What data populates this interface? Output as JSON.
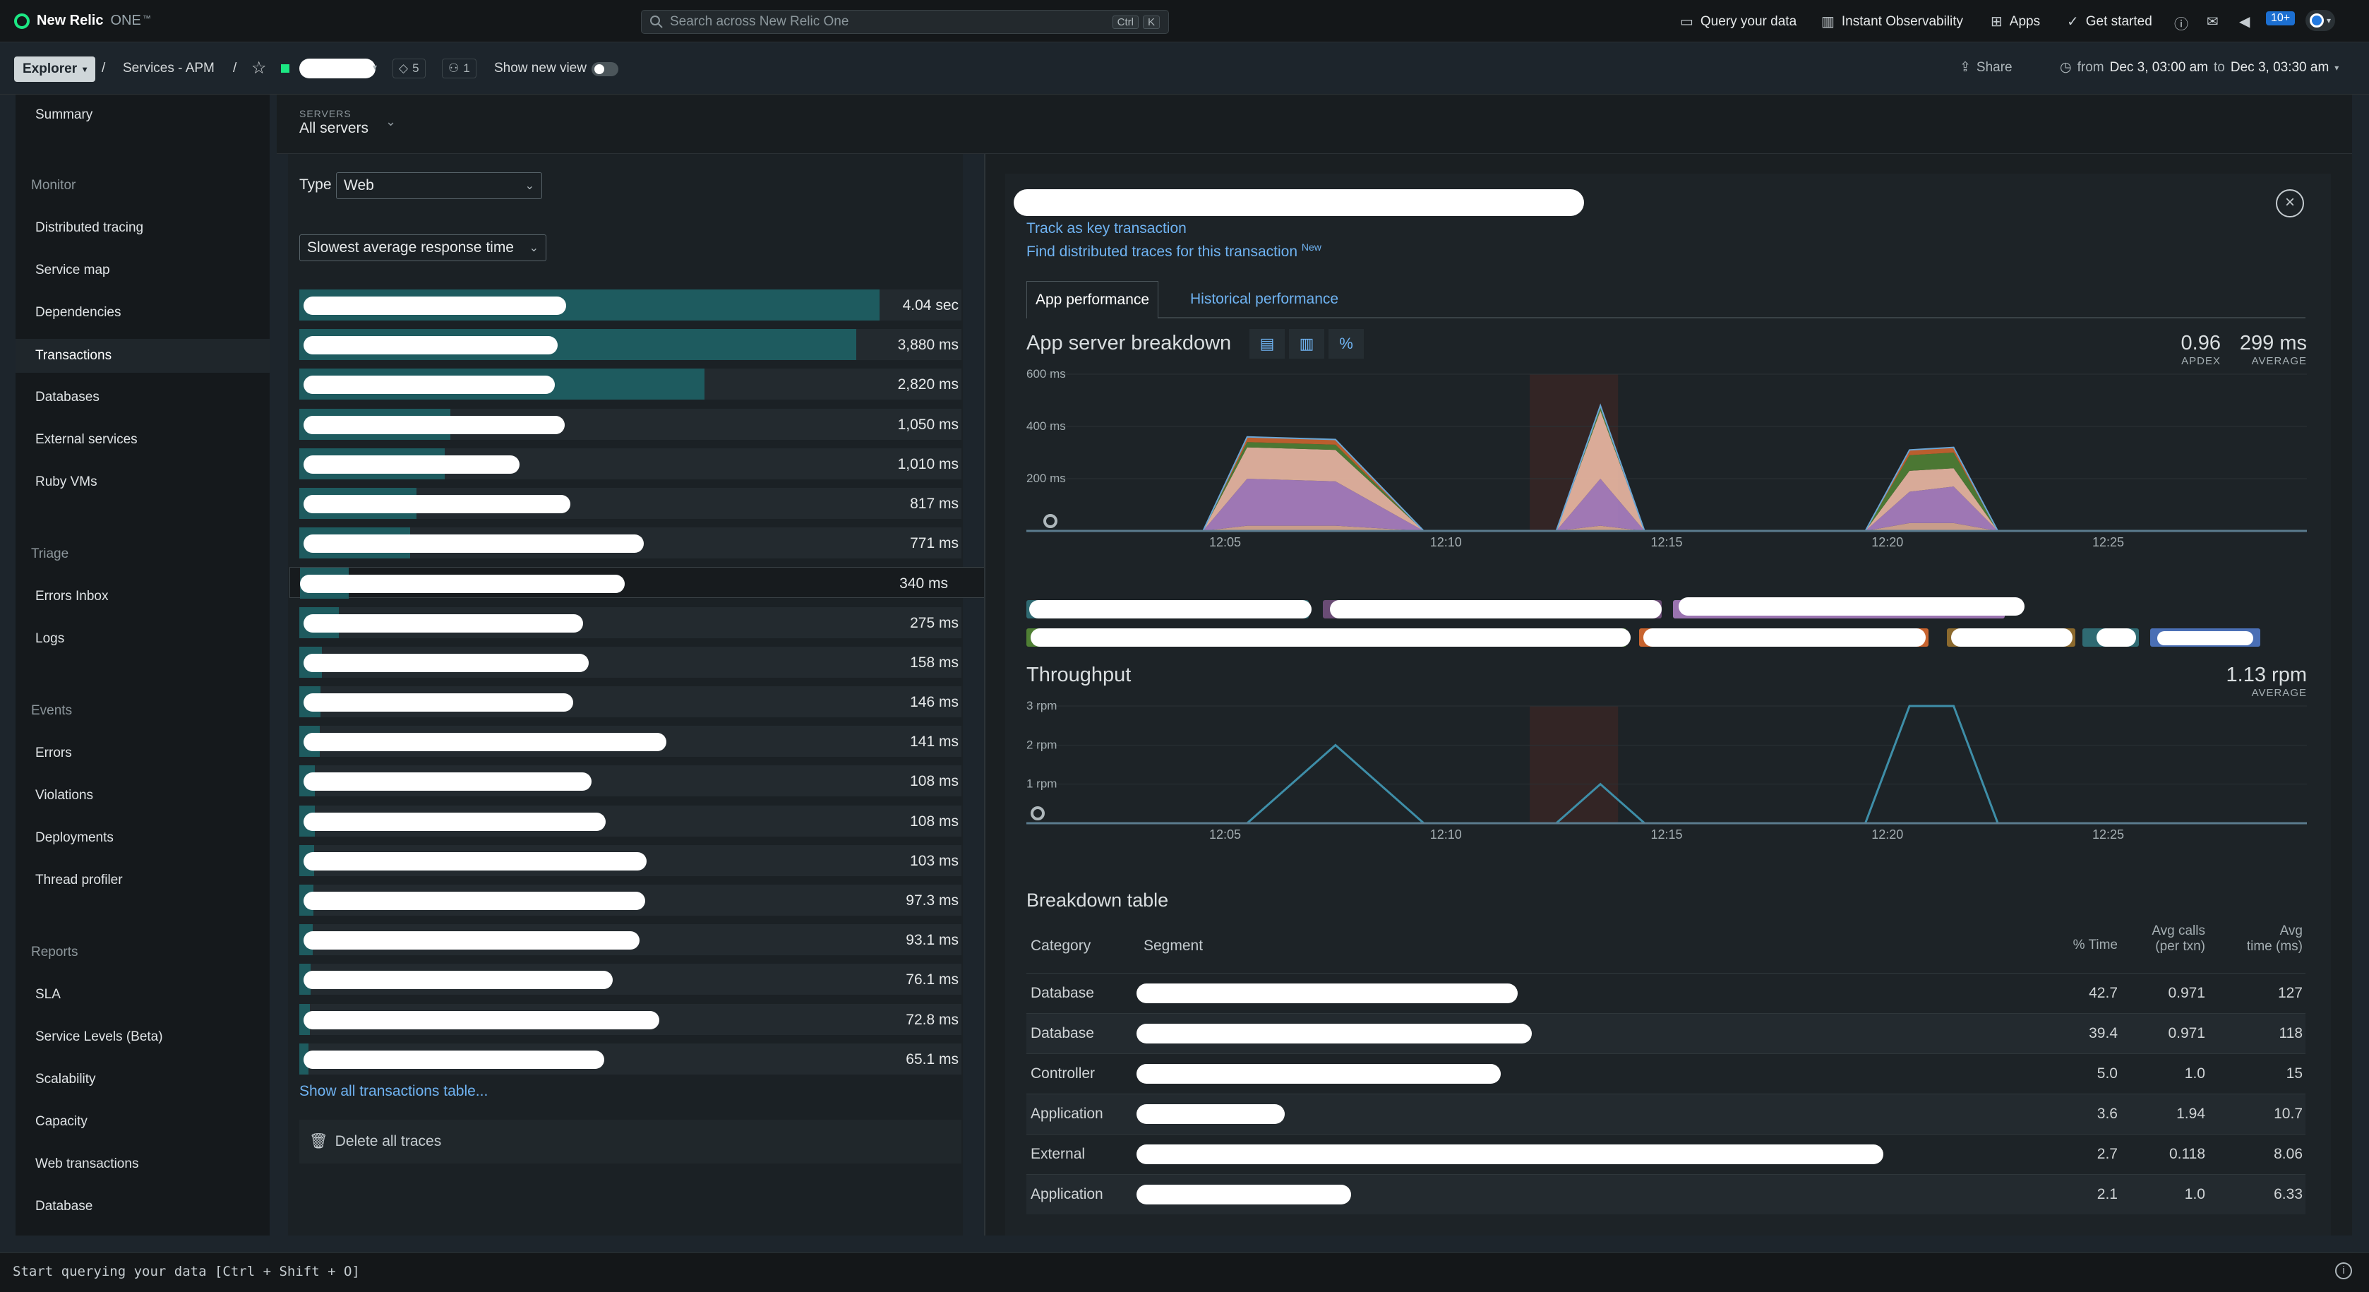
{
  "app": {
    "brand": "New Relic",
    "brand_suffix": "ONE",
    "tm": "™"
  },
  "search": {
    "placeholder": "Search across New Relic One",
    "shortcut": [
      "Ctrl",
      "K"
    ]
  },
  "top_actions": {
    "query": "Query your data",
    "observability": "Instant Observability",
    "apps": "Apps",
    "get_started": "Get started",
    "notifications_badge": "10+"
  },
  "subheader": {
    "explorer": "Explorer",
    "sep1": "/",
    "crumb": "Services - APM",
    "sep2": "/",
    "tags_count": "5",
    "workloads_count": "1",
    "show_new_view": "Show new view",
    "share": "Share",
    "time_from_label": "from",
    "time_from": "Dec 3, 03:00 am",
    "time_to_label": "to",
    "time_to": "Dec 3, 03:30 am"
  },
  "nav": {
    "summary": "Summary",
    "monitor_section": "Monitor",
    "monitor": [
      "Distributed tracing",
      "Service map",
      "Dependencies",
      "Transactions",
      "Databases",
      "External services",
      "Ruby VMs"
    ],
    "triage_section": "Triage",
    "triage": [
      "Errors Inbox",
      "Logs"
    ],
    "events_section": "Events",
    "events": [
      "Errors",
      "Violations",
      "Deployments",
      "Thread profiler"
    ],
    "reports_section": "Reports",
    "reports": [
      "SLA",
      "Service Levels (Beta)",
      "Scalability",
      "Capacity",
      "Web transactions",
      "Database"
    ]
  },
  "servers": {
    "label": "SERVERS",
    "value": "All servers"
  },
  "filters": {
    "type_label": "Type",
    "type_value": "Web",
    "sort_value": "Slowest average response time"
  },
  "transactions": [
    {
      "value": "4.04 sec",
      "fraction": 1.0
    },
    {
      "value": "3,880 ms",
      "fraction": 0.96
    },
    {
      "value": "2,820 ms",
      "fraction": 0.698
    },
    {
      "value": "1,050 ms",
      "fraction": 0.26
    },
    {
      "value": "1,010 ms",
      "fraction": 0.25
    },
    {
      "value": "817 ms",
      "fraction": 0.202
    },
    {
      "value": "771 ms",
      "fraction": 0.191
    },
    {
      "value": "340 ms",
      "fraction": 0.084
    },
    {
      "value": "275 ms",
      "fraction": 0.068
    },
    {
      "value": "158 ms",
      "fraction": 0.039
    },
    {
      "value": "146 ms",
      "fraction": 0.036
    },
    {
      "value": "141 ms",
      "fraction": 0.035
    },
    {
      "value": "108 ms",
      "fraction": 0.027
    },
    {
      "value": "108 ms",
      "fraction": 0.027
    },
    {
      "value": "103 ms",
      "fraction": 0.025
    },
    {
      "value": "97.3 ms",
      "fraction": 0.024
    },
    {
      "value": "93.1 ms",
      "fraction": 0.023
    },
    {
      "value": "76.1 ms",
      "fraction": 0.019
    },
    {
      "value": "72.8 ms",
      "fraction": 0.018
    },
    {
      "value": "65.1 ms",
      "fraction": 0.016
    }
  ],
  "list_footer": {
    "show_all": "Show all transactions table...",
    "delete_traces": "Delete all traces"
  },
  "detail": {
    "track_key": "Track as key transaction",
    "find_traces": "Find distributed traces for this transaction",
    "find_traces_badge": "New",
    "tab_app": "App performance",
    "tab_hist": "Historical performance",
    "breakdown_title": "App server breakdown",
    "apdex_value": "0.96",
    "apdex_label": "APDEX",
    "avg_value": "299 ms",
    "avg_label": "AVERAGE",
    "throughput_title": "Throughput",
    "throughput_value": "1.13 rpm",
    "throughput_label": "AVERAGE",
    "chart_btn_pct": "%"
  },
  "colors": {
    "teal_bar": "#1e5b5f",
    "link": "#6fb3f2",
    "accent_green": "#1ce783",
    "series_line": "#3e8ea8"
  },
  "chart_data": [
    {
      "type": "area",
      "ylim": [
        0,
        600
      ],
      "yticks": [
        "600 ms",
        "400 ms",
        "200 ms"
      ],
      "xticks": [
        "12:05",
        "12:10",
        "12:15",
        "12:20",
        "12:25"
      ],
      "x": [
        0,
        2,
        4,
        5,
        7,
        9,
        11,
        12,
        13,
        14,
        15,
        17,
        19,
        20,
        21,
        22,
        23,
        25,
        27,
        29
      ],
      "series": [
        {
          "values": [
            0,
            0,
            0,
            20,
            20,
            0,
            0,
            0,
            20,
            0,
            0,
            0,
            0,
            30,
            30,
            0,
            0,
            0,
            0,
            0
          ],
          "color": "#d7a892"
        },
        {
          "values": [
            0,
            0,
            0,
            180,
            170,
            0,
            0,
            0,
            180,
            0,
            0,
            0,
            0,
            120,
            140,
            0,
            0,
            0,
            0,
            0
          ],
          "color": "#a97fc0"
        },
        {
          "values": [
            0,
            0,
            0,
            120,
            120,
            0,
            0,
            0,
            260,
            0,
            0,
            0,
            0,
            80,
            70,
            0,
            0,
            0,
            0,
            0
          ],
          "color": "#e8b6a2"
        },
        {
          "values": [
            0,
            0,
            0,
            20,
            20,
            0,
            0,
            0,
            20,
            0,
            0,
            0,
            0,
            60,
            60,
            0,
            0,
            0,
            0,
            0
          ],
          "color": "#4f7f34"
        },
        {
          "values": [
            0,
            0,
            0,
            20,
            20,
            0,
            0,
            0,
            0,
            0,
            0,
            0,
            0,
            20,
            20,
            0,
            0,
            0,
            0,
            0
          ],
          "color": "#c8642f"
        }
      ]
    },
    {
      "type": "line",
      "ylim": [
        0,
        3
      ],
      "yticks": [
        "3 rpm",
        "2 rpm",
        "1 rpm"
      ],
      "xticks": [
        "12:05",
        "12:10",
        "12:15",
        "12:20",
        "12:25"
      ],
      "x": [
        0,
        2,
        4,
        5,
        7,
        9,
        11,
        12,
        13,
        14,
        15,
        17,
        19,
        20,
        21,
        22,
        23,
        25,
        27,
        29
      ],
      "series": [
        {
          "values": [
            0,
            0,
            0,
            0,
            2,
            0,
            0,
            0,
            1,
            0,
            0,
            0,
            0,
            3,
            3,
            0,
            0,
            0,
            0,
            0
          ]
        }
      ]
    }
  ],
  "breakdown_table": {
    "title": "Breakdown table",
    "headers": {
      "category": "Category",
      "segment": "Segment",
      "pct": "% Time",
      "calls1": "Avg calls",
      "calls2": "(per txn)",
      "time1": "Avg",
      "time2": "time (ms)"
    },
    "rows": [
      {
        "category": "Database",
        "pct": "42.7",
        "calls": "0.971",
        "time": "127"
      },
      {
        "category": "Database",
        "pct": "39.4",
        "calls": "0.971",
        "time": "118"
      },
      {
        "category": "Controller",
        "pct": "5.0",
        "calls": "1.0",
        "time": "15"
      },
      {
        "category": "Application",
        "pct": "3.6",
        "calls": "1.94",
        "time": "10.7"
      },
      {
        "category": "External",
        "pct": "2.7",
        "calls": "0.118",
        "time": "8.06"
      },
      {
        "category": "Application",
        "pct": "2.1",
        "calls": "1.0",
        "time": "6.33"
      }
    ]
  },
  "querybar": {
    "text": "Start querying your data [Ctrl + Shift + O]"
  }
}
